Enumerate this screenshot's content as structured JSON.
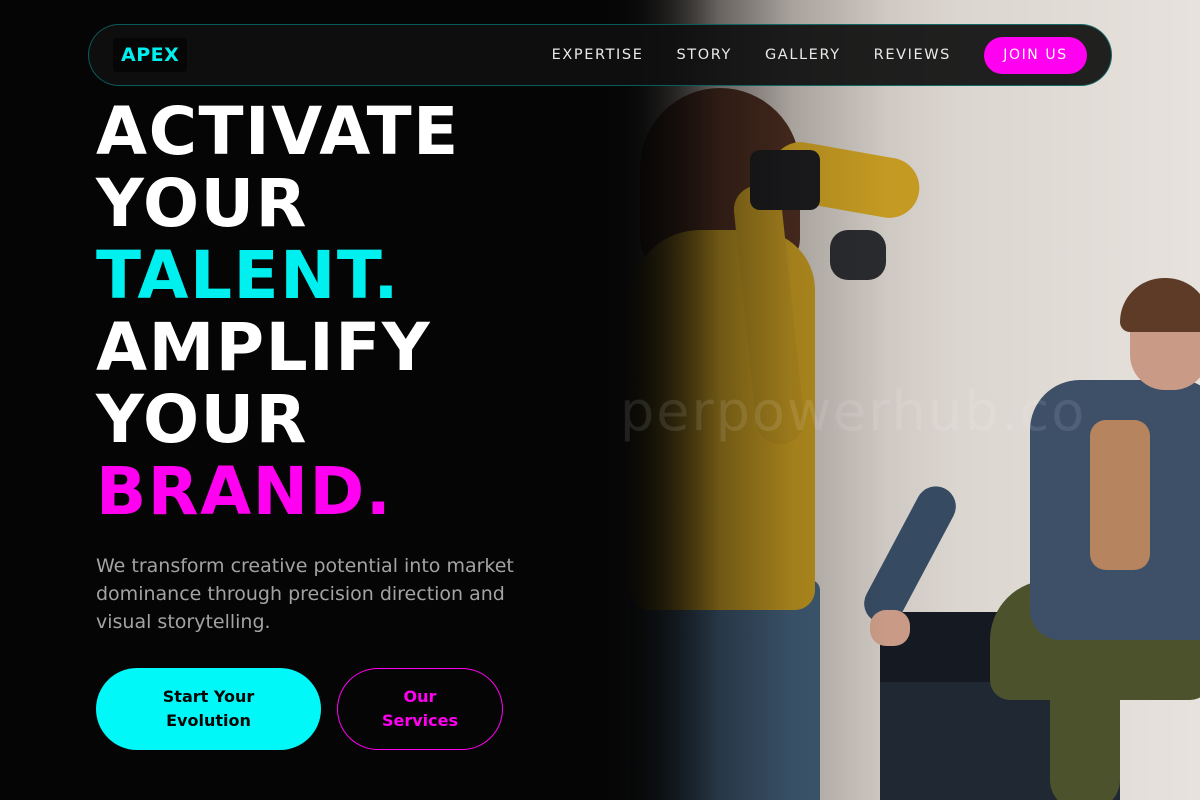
{
  "nav": {
    "logo": "APEX",
    "links": [
      "EXPERTISE",
      "STORY",
      "GALLERY",
      "REVIEWS"
    ],
    "cta": "JOIN US"
  },
  "hero": {
    "headline_lines": [
      "ACTIVATE",
      "YOUR",
      "TALENT.",
      "AMPLIFY",
      "YOUR",
      "BRAND."
    ],
    "lede": "We transform creative potential into market dominance through precision direction and visual storytelling.",
    "primary_cta": [
      "Start Your",
      "Evolution"
    ],
    "secondary_cta": [
      "Our",
      "Services"
    ]
  },
  "photo": {
    "watermark": "perpowerhub.co"
  },
  "colors": {
    "background": "#050505",
    "accent_cyan": "#00f0f0",
    "accent_magenta": "#ff00f0",
    "text_primary": "#ffffff",
    "text_muted": "#a3a3a3"
  }
}
